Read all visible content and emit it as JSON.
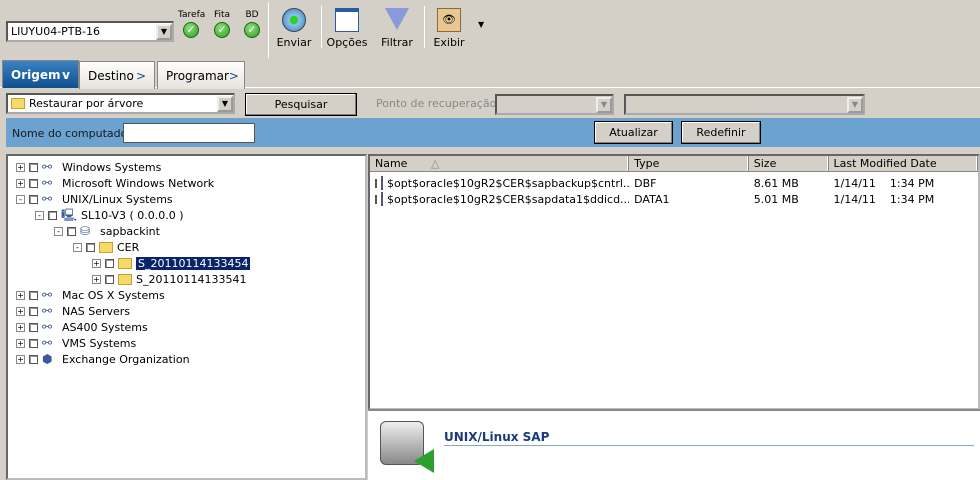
{
  "toolbar": {
    "server": "LIUYU04-PTB-16",
    "status": [
      {
        "label": "Tarefa"
      },
      {
        "label": "Fita"
      },
      {
        "label": "BD"
      }
    ],
    "buttons": [
      {
        "label": "Enviar",
        "icon": "submit-icon"
      },
      {
        "label": "Opções",
        "icon": "options-icon"
      },
      {
        "label": "Filtrar",
        "icon": "filter-icon"
      },
      {
        "label": "Exibir",
        "icon": "view-icon"
      }
    ]
  },
  "tabs": [
    {
      "label": "Origem"
    },
    {
      "label": "Destino"
    },
    {
      "label": "Programar"
    }
  ],
  "controls": {
    "restore_mode": "Restaurar por árvore",
    "search_label": "Pesquisar",
    "recovery_point_label": "Ponto de recuperação:",
    "computer_name_label": "Nome do computador:",
    "computer_name_value": "",
    "refresh_label": "Atualizar",
    "reset_label": "Redefinir"
  },
  "tree": [
    {
      "label": "Windows Systems",
      "depth": 0,
      "exp": "+",
      "icon": "network"
    },
    {
      "label": "Microsoft Windows Network",
      "depth": 0,
      "exp": "+",
      "icon": "network"
    },
    {
      "label": "UNIX/Linux Systems",
      "depth": 0,
      "exp": "-",
      "icon": "network"
    },
    {
      "label": "SL10-V3 ( 0.0.0.0 )",
      "depth": 1,
      "exp": "-",
      "icon": "computer"
    },
    {
      "label": "sapbackint",
      "depth": 2,
      "exp": "-",
      "icon": "database"
    },
    {
      "label": "CER",
      "depth": 3,
      "exp": "-",
      "icon": "folder"
    },
    {
      "label": "S_20110114133454",
      "depth": 4,
      "exp": "+",
      "icon": "folder",
      "selected": true
    },
    {
      "label": "S_20110114133541",
      "depth": 4,
      "exp": "+",
      "icon": "folder"
    },
    {
      "label": "Mac OS X Systems",
      "depth": 0,
      "exp": "+",
      "icon": "network"
    },
    {
      "label": "NAS Servers",
      "depth": 0,
      "exp": "+",
      "icon": "network"
    },
    {
      "label": "AS400 Systems",
      "depth": 0,
      "exp": "+",
      "icon": "network"
    },
    {
      "label": "VMS Systems",
      "depth": 0,
      "exp": "+",
      "icon": "network"
    },
    {
      "label": "Exchange Organization",
      "depth": 0,
      "exp": "+",
      "icon": "exchange"
    }
  ],
  "files": {
    "columns": [
      "Name",
      "Type",
      "Size",
      "Last Modified Date"
    ],
    "rows": [
      {
        "name": "$opt$oracle$10gR2$CER$sapbackup$cntrl...",
        "type": "DBF",
        "size": "8.61 MB",
        "date": "1/14/11    1:34 PM"
      },
      {
        "name": "$opt$oracle$10gR2$CER$sapdata1$ddicd...",
        "type": "DATA1",
        "size": "5.01 MB",
        "date": "1/14/11    1:34 PM"
      }
    ]
  },
  "info": {
    "title": "UNIX/Linux SAP"
  },
  "colors": {
    "blue_bar": "#6ba2d0",
    "tab_active": "#1a5fa0",
    "selection": "#0a246a"
  }
}
